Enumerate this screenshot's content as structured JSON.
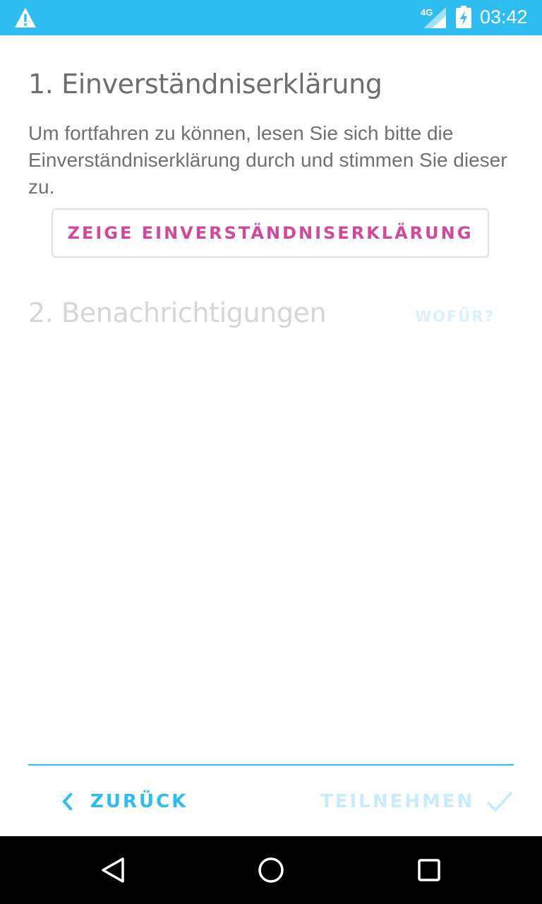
{
  "status_bar": {
    "time": "03:42",
    "network": "4G",
    "icons": [
      "warning-icon",
      "signal-icon",
      "battery-charging-icon"
    ],
    "background": "#2dbdf0"
  },
  "step1": {
    "title": "1. Einverständniserklärung",
    "description": "Um fortfahren zu können, lesen Sie sich bitte die Einverständniserklärung durch und stimmen Sie dieser zu.",
    "button_label": "ZEIGE EINVERSTÄNDNISERKLÄRUNG"
  },
  "step2": {
    "title": "2. Benachrichtigungen",
    "why_label": "WOFÜR?"
  },
  "footer": {
    "back_label": "ZURÜCK",
    "join_label": "TEILNEHMEN"
  },
  "nav_bar": {
    "icons": [
      "nav-back-icon",
      "nav-home-icon",
      "nav-recents-icon"
    ]
  },
  "colors": {
    "accent": "#2dbdf0",
    "button_text": "#d2489a",
    "disabled": "#c8ecfb"
  }
}
